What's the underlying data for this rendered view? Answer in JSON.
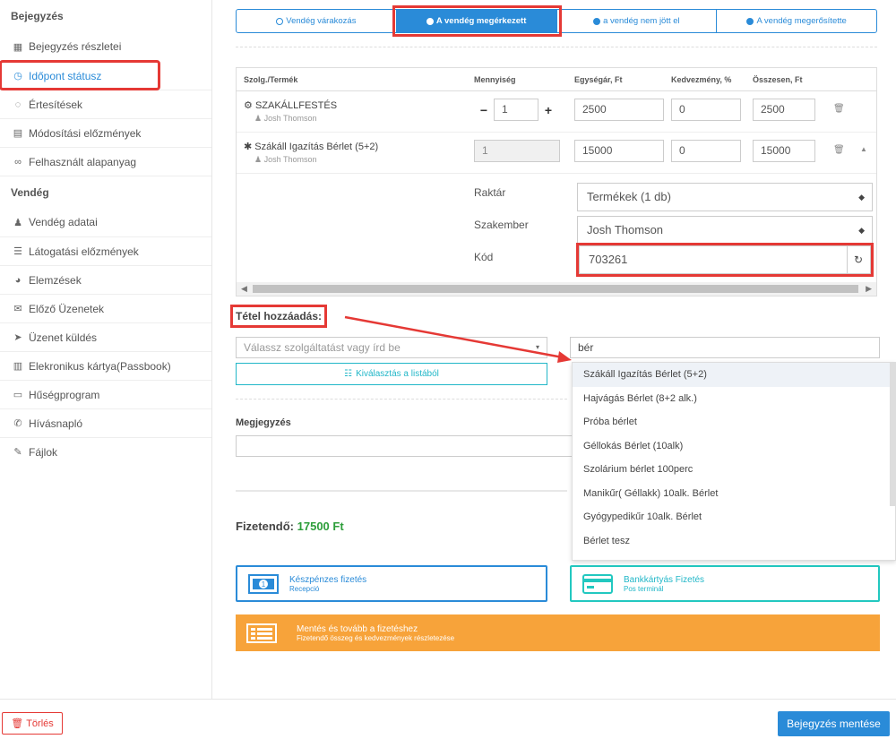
{
  "sidebar": {
    "section1": "Bejegyzés",
    "items1": [
      {
        "label": "Bejegyzés részletei",
        "icon": "calendar-icon"
      },
      {
        "label": "Időpont státusz",
        "icon": "clock-icon"
      },
      {
        "label": "Értesítések",
        "icon": "comments-icon"
      },
      {
        "label": "Módosítási előzmények",
        "icon": "file-icon"
      },
      {
        "label": "Felhasznált alapanyag",
        "icon": "link-icon"
      }
    ],
    "section2": "Vendég",
    "items2": [
      {
        "label": "Vendég adatai",
        "icon": "user-icon"
      },
      {
        "label": "Látogatási előzmények",
        "icon": "list-icon"
      },
      {
        "label": "Elemzések",
        "icon": "pie-icon"
      },
      {
        "label": "Előző Üzenetek",
        "icon": "envelope-icon"
      },
      {
        "label": "Üzenet küldés",
        "icon": "send-icon"
      },
      {
        "label": "Elekronikus kártya(Passbook)",
        "icon": "card-icon"
      },
      {
        "label": "Hűségprogram",
        "icon": "credit-card-icon"
      },
      {
        "label": "Hívásnapló",
        "icon": "phone-icon"
      },
      {
        "label": "Fájlok",
        "icon": "paperclip-icon"
      }
    ]
  },
  "status_tabs": [
    {
      "label": "Vendég várakozás",
      "active": false
    },
    {
      "label": "A vendég megérkezett",
      "active": true
    },
    {
      "label": "a vendég nem jött el",
      "active": false
    },
    {
      "label": "A vendég megerősítette",
      "active": false
    }
  ],
  "table": {
    "headers": [
      "Szolg./Termék",
      "Mennyiség",
      "Egységár, Ft",
      "Kedvezmény, %",
      "Összesen, Ft"
    ],
    "rows": [
      {
        "name": "SZAKÁLLFESTÉS",
        "staff": "Josh Thomson",
        "qty": "1",
        "price": "2500",
        "discount": "0",
        "total": "2500"
      },
      {
        "name": "Szákáll Igazítás Bérlet (5+2)",
        "staff": "Josh Thomson",
        "qty": "1",
        "price": "15000",
        "discount": "0",
        "total": "15000"
      }
    ],
    "details": {
      "warehouse_label": "Raktár",
      "warehouse_value": "Termékek (1 db)",
      "specialist_label": "Szakember",
      "specialist_value": "Josh Thomson",
      "code_label": "Kód",
      "code_value": "703261"
    }
  },
  "add_item": {
    "title": "Tétel hozzáadás:",
    "service_placeholder": "Válassz szolgáltatást vagy írd be",
    "search_value": "bér",
    "list_button": "Kiválasztás a listából"
  },
  "dropdown": [
    "Szákáll Igazítás Bérlet (5+2)",
    "Hajvágás Bérlet (8+2 alk.)",
    "Próba bérlet",
    "Géllokás Bérlet (10alk)",
    "Szolárium bérlet 100perc",
    "Manikűr( Géllakk) 10alk. Bérlet",
    "Gyógypedikűr 10alk. Bérlet",
    "Bérlet tesz"
  ],
  "note_label": "Megjegyzés",
  "total": {
    "label": "Fizetendő:",
    "amount": "17500 Ft"
  },
  "payments": {
    "cash_title": "Készpénzes fizetés",
    "cash_sub": "Recepció",
    "card_title": "Bankkártyás Fizetés",
    "card_sub": "Pos terminál",
    "continue_title": "Mentés és tovább a fizetéshez",
    "continue_sub": "Fizetendő összeg és kedvezmények részletezése"
  },
  "footer": {
    "delete": "Törlés",
    "save": "Bejegyzés mentése"
  },
  "colors": {
    "primary": "#2a8bd8",
    "teal": "#22b7c8",
    "orange": "#f7a33a",
    "red": "#e53935",
    "green": "#2e9e3b"
  }
}
